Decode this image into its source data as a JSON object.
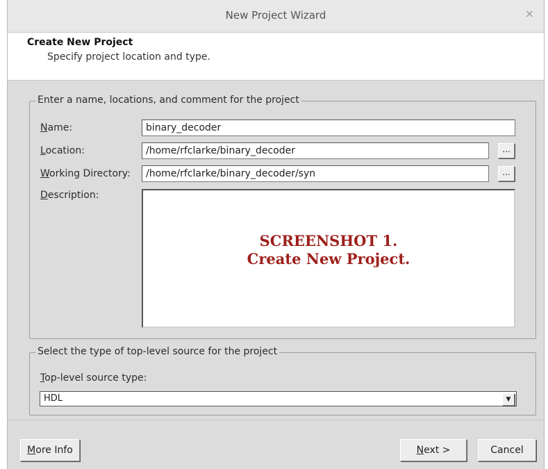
{
  "window": {
    "title": "New Project Wizard",
    "close_glyph": "×"
  },
  "header": {
    "title": "Create New Project",
    "subtitle": "Specify project location and type."
  },
  "project_group": {
    "legend": "Enter a name, locations, and comment for the project",
    "name_label": "Name:",
    "name_value": "binary_decoder",
    "location_label": "Location:",
    "location_value": "/home/rfclarke/binary_decoder",
    "workdir_label": "Working Directory:",
    "workdir_value": "/home/rfclarke/binary_decoder/syn",
    "description_label": "Description:",
    "browse_label": "...",
    "watermark_line1": "SCREENSHOT 1.",
    "watermark_line2": "Create New Project."
  },
  "source_group": {
    "legend": "Select the type of top-level source for the project",
    "type_label": "Top-level source type:",
    "type_value": "HDL"
  },
  "buttons": {
    "more_info": "More Info",
    "next": "Next >",
    "cancel": "Cancel"
  }
}
